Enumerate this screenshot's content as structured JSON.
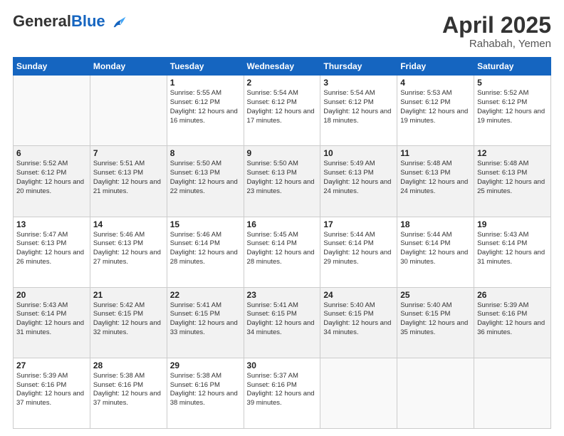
{
  "logo": {
    "general": "General",
    "blue": "Blue"
  },
  "title": "April 2025",
  "location": "Rahabah, Yemen",
  "days_of_week": [
    "Sunday",
    "Monday",
    "Tuesday",
    "Wednesday",
    "Thursday",
    "Friday",
    "Saturday"
  ],
  "weeks": [
    [
      {
        "day": "",
        "info": ""
      },
      {
        "day": "",
        "info": ""
      },
      {
        "day": "1",
        "info": "Sunrise: 5:55 AM\nSunset: 6:12 PM\nDaylight: 12 hours and 16 minutes."
      },
      {
        "day": "2",
        "info": "Sunrise: 5:54 AM\nSunset: 6:12 PM\nDaylight: 12 hours and 17 minutes."
      },
      {
        "day": "3",
        "info": "Sunrise: 5:54 AM\nSunset: 6:12 PM\nDaylight: 12 hours and 18 minutes."
      },
      {
        "day": "4",
        "info": "Sunrise: 5:53 AM\nSunset: 6:12 PM\nDaylight: 12 hours and 19 minutes."
      },
      {
        "day": "5",
        "info": "Sunrise: 5:52 AM\nSunset: 6:12 PM\nDaylight: 12 hours and 19 minutes."
      }
    ],
    [
      {
        "day": "6",
        "info": "Sunrise: 5:52 AM\nSunset: 6:12 PM\nDaylight: 12 hours and 20 minutes."
      },
      {
        "day": "7",
        "info": "Sunrise: 5:51 AM\nSunset: 6:13 PM\nDaylight: 12 hours and 21 minutes."
      },
      {
        "day": "8",
        "info": "Sunrise: 5:50 AM\nSunset: 6:13 PM\nDaylight: 12 hours and 22 minutes."
      },
      {
        "day": "9",
        "info": "Sunrise: 5:50 AM\nSunset: 6:13 PM\nDaylight: 12 hours and 23 minutes."
      },
      {
        "day": "10",
        "info": "Sunrise: 5:49 AM\nSunset: 6:13 PM\nDaylight: 12 hours and 24 minutes."
      },
      {
        "day": "11",
        "info": "Sunrise: 5:48 AM\nSunset: 6:13 PM\nDaylight: 12 hours and 24 minutes."
      },
      {
        "day": "12",
        "info": "Sunrise: 5:48 AM\nSunset: 6:13 PM\nDaylight: 12 hours and 25 minutes."
      }
    ],
    [
      {
        "day": "13",
        "info": "Sunrise: 5:47 AM\nSunset: 6:13 PM\nDaylight: 12 hours and 26 minutes."
      },
      {
        "day": "14",
        "info": "Sunrise: 5:46 AM\nSunset: 6:13 PM\nDaylight: 12 hours and 27 minutes."
      },
      {
        "day": "15",
        "info": "Sunrise: 5:46 AM\nSunset: 6:14 PM\nDaylight: 12 hours and 28 minutes."
      },
      {
        "day": "16",
        "info": "Sunrise: 5:45 AM\nSunset: 6:14 PM\nDaylight: 12 hours and 28 minutes."
      },
      {
        "day": "17",
        "info": "Sunrise: 5:44 AM\nSunset: 6:14 PM\nDaylight: 12 hours and 29 minutes."
      },
      {
        "day": "18",
        "info": "Sunrise: 5:44 AM\nSunset: 6:14 PM\nDaylight: 12 hours and 30 minutes."
      },
      {
        "day": "19",
        "info": "Sunrise: 5:43 AM\nSunset: 6:14 PM\nDaylight: 12 hours and 31 minutes."
      }
    ],
    [
      {
        "day": "20",
        "info": "Sunrise: 5:43 AM\nSunset: 6:14 PM\nDaylight: 12 hours and 31 minutes."
      },
      {
        "day": "21",
        "info": "Sunrise: 5:42 AM\nSunset: 6:15 PM\nDaylight: 12 hours and 32 minutes."
      },
      {
        "day": "22",
        "info": "Sunrise: 5:41 AM\nSunset: 6:15 PM\nDaylight: 12 hours and 33 minutes."
      },
      {
        "day": "23",
        "info": "Sunrise: 5:41 AM\nSunset: 6:15 PM\nDaylight: 12 hours and 34 minutes."
      },
      {
        "day": "24",
        "info": "Sunrise: 5:40 AM\nSunset: 6:15 PM\nDaylight: 12 hours and 34 minutes."
      },
      {
        "day": "25",
        "info": "Sunrise: 5:40 AM\nSunset: 6:15 PM\nDaylight: 12 hours and 35 minutes."
      },
      {
        "day": "26",
        "info": "Sunrise: 5:39 AM\nSunset: 6:16 PM\nDaylight: 12 hours and 36 minutes."
      }
    ],
    [
      {
        "day": "27",
        "info": "Sunrise: 5:39 AM\nSunset: 6:16 PM\nDaylight: 12 hours and 37 minutes."
      },
      {
        "day": "28",
        "info": "Sunrise: 5:38 AM\nSunset: 6:16 PM\nDaylight: 12 hours and 37 minutes."
      },
      {
        "day": "29",
        "info": "Sunrise: 5:38 AM\nSunset: 6:16 PM\nDaylight: 12 hours and 38 minutes."
      },
      {
        "day": "30",
        "info": "Sunrise: 5:37 AM\nSunset: 6:16 PM\nDaylight: 12 hours and 39 minutes."
      },
      {
        "day": "",
        "info": ""
      },
      {
        "day": "",
        "info": ""
      },
      {
        "day": "",
        "info": ""
      }
    ]
  ]
}
